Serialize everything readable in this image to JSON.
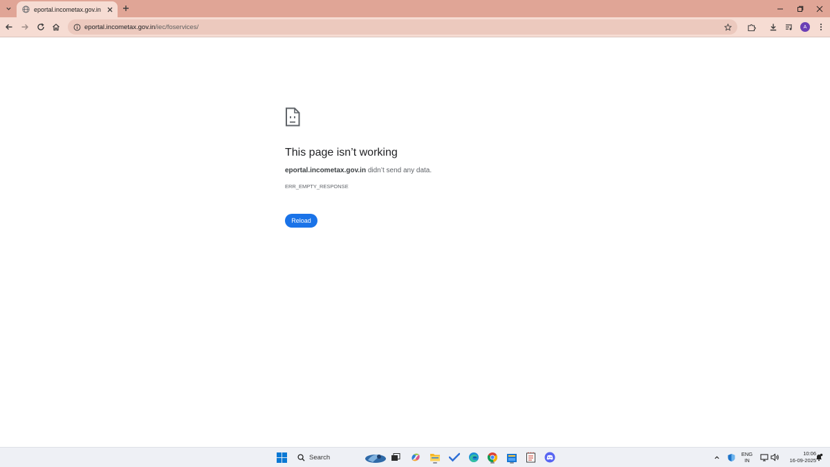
{
  "browser": {
    "tab": {
      "title": "eportal.incometax.gov.in"
    },
    "address_bar": {
      "host": "eportal.incometax.gov.in",
      "path": "/iec/foservices/"
    },
    "profile_initial": "A"
  },
  "error_page": {
    "title": "This page isn’t working",
    "host": "eportal.incometax.gov.in",
    "message": " didn’t send any data.",
    "code": "ERR_EMPTY_RESPONSE",
    "reload_label": "Reload"
  },
  "taskbar": {
    "search_label": "Search",
    "language": {
      "line1": "ENG",
      "line2": "IN"
    },
    "clock": {
      "time": "10:06",
      "date": "16-09-2025"
    },
    "pinned": [
      "windows-start-icon",
      "search-icon",
      "widgets-icon",
      "task-view-icon",
      "copilot-icon",
      "file-explorer-icon",
      "todo-icon",
      "edge-icon",
      "chrome-icon",
      "store-icon",
      "notepad-icon",
      "discord-icon"
    ]
  },
  "colors": {
    "tabstrip": "#e0a596",
    "toolbar": "#f6dcd3",
    "accent_blue": "#1a73e8"
  }
}
